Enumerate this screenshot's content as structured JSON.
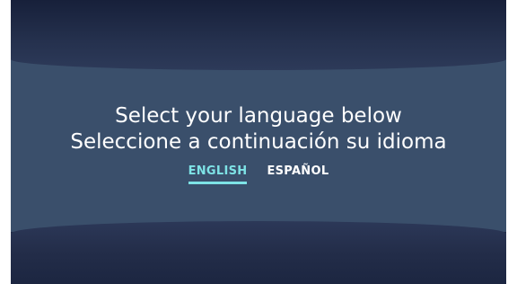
{
  "prompt": {
    "line_en": "Select your language below",
    "line_es": "Seleccione a continuación su idioma"
  },
  "languages": [
    {
      "label": "ENGLISH",
      "selected": true
    },
    {
      "label": "ESPAÑOL",
      "selected": false
    }
  ],
  "colors": {
    "background_dark": "#1f2a44",
    "panel": "#3a4f6b",
    "accent": "#7ee3e6",
    "text": "#ffffff"
  }
}
